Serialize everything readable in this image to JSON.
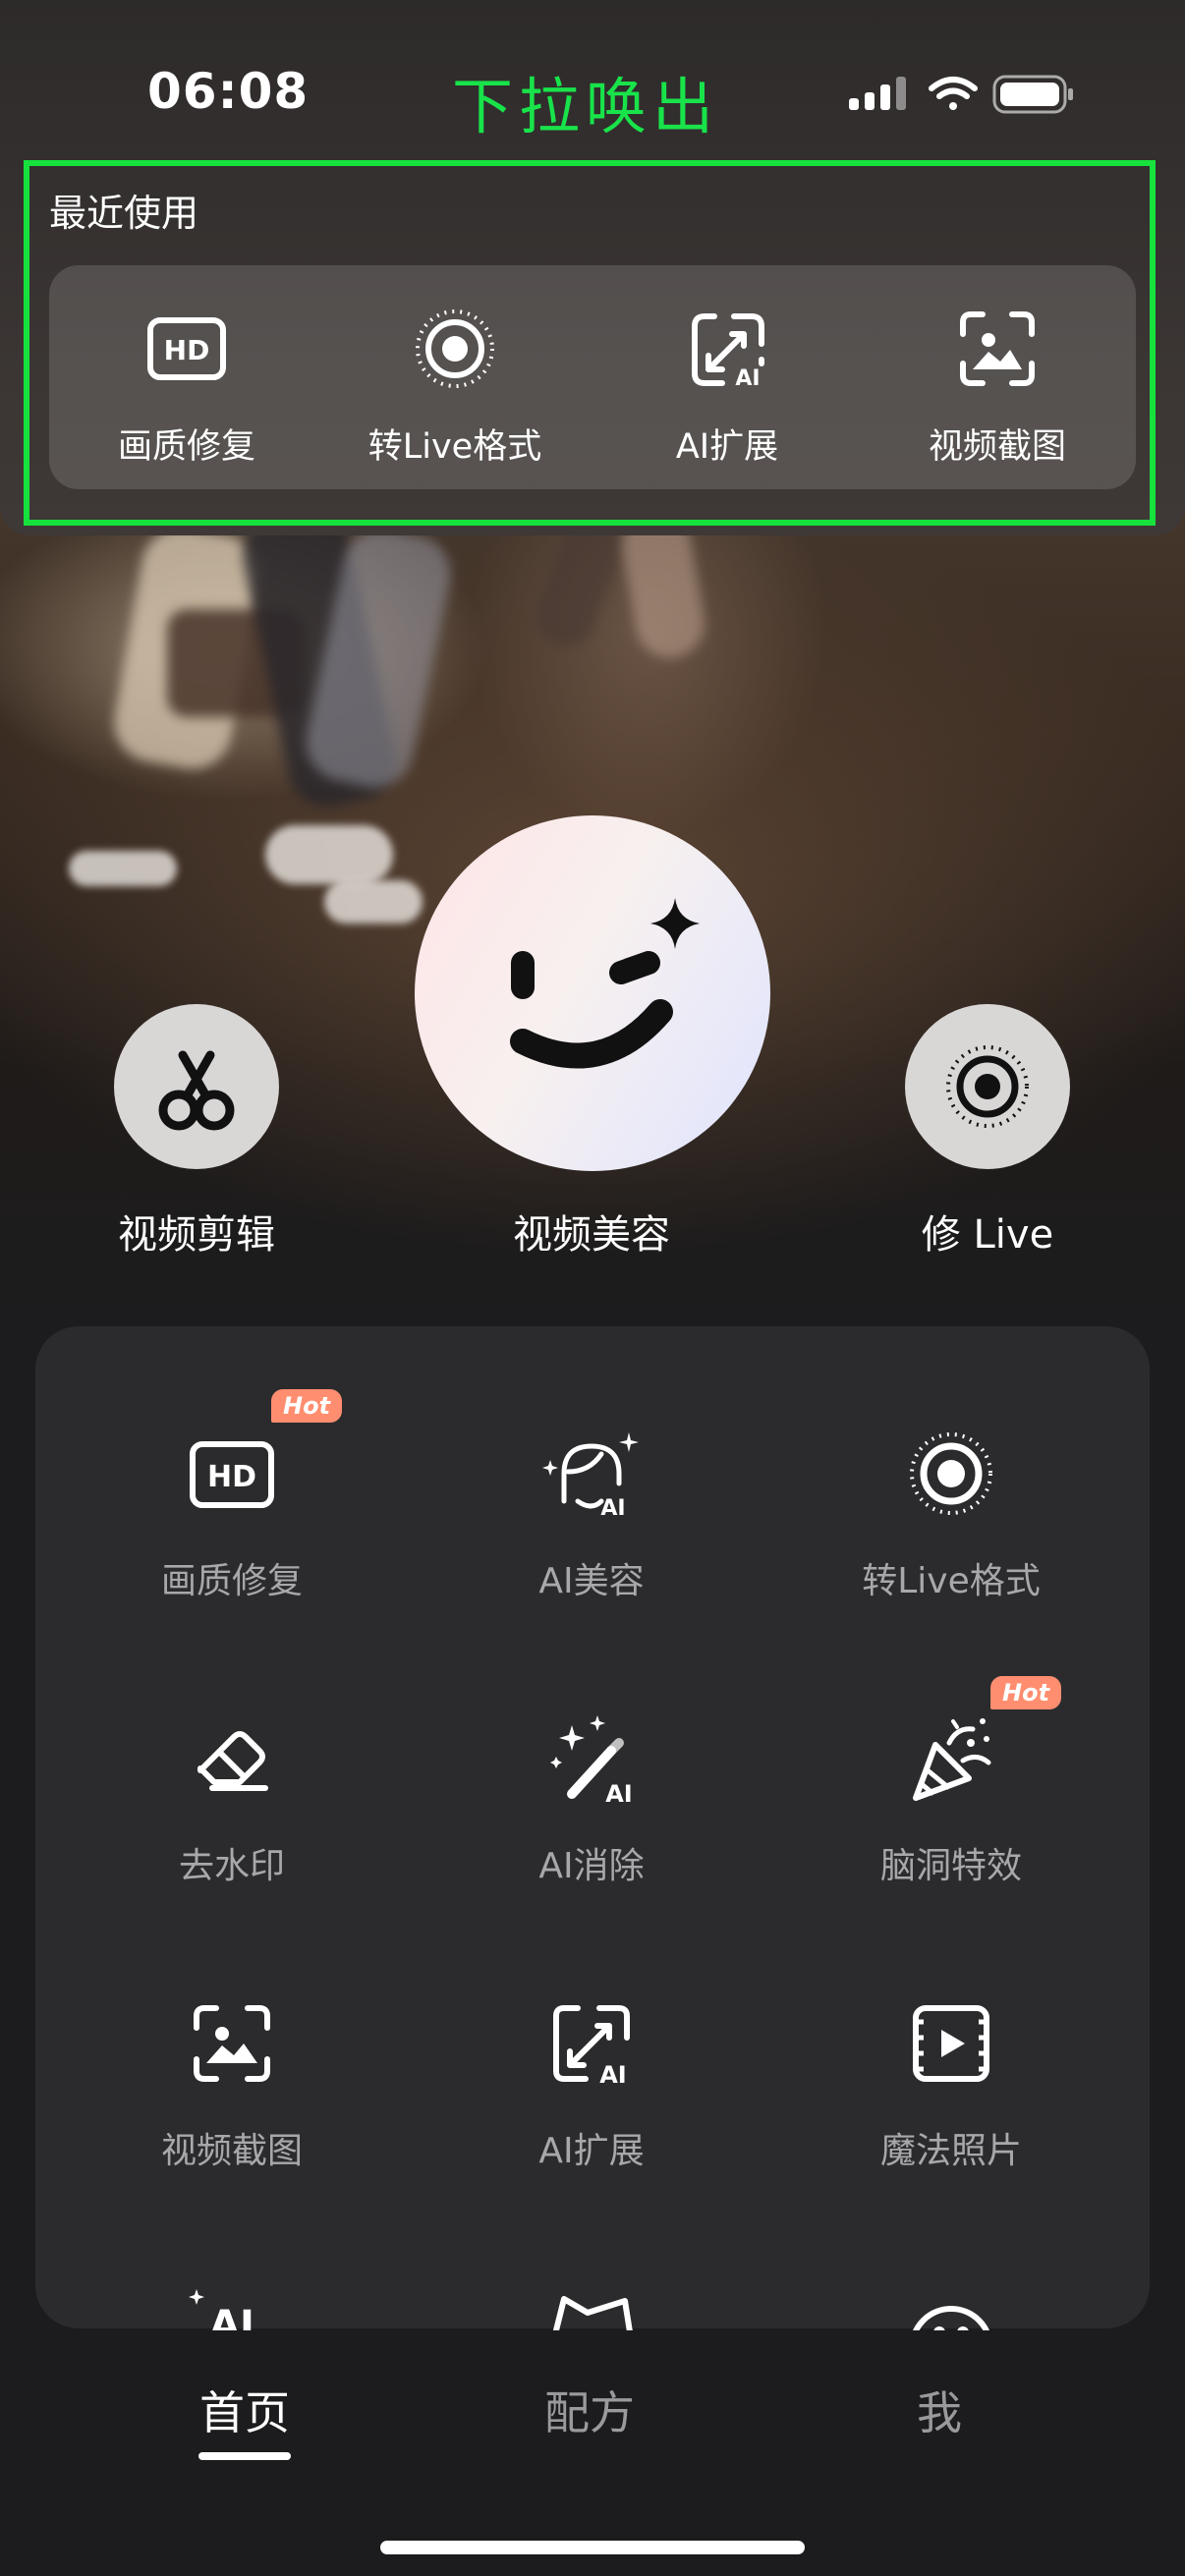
{
  "status_bar": {
    "time": "06:08"
  },
  "overlay_title": "下拉唤出",
  "recent": {
    "title": "最近使用",
    "items": [
      {
        "label": "画质修复",
        "icon": "hd-icon"
      },
      {
        "label": "转Live格式",
        "icon": "live-photo-icon"
      },
      {
        "label": "AI扩展",
        "icon": "ai-expand-icon"
      },
      {
        "label": "视频截图",
        "icon": "video-screenshot-icon"
      }
    ]
  },
  "main_actions": {
    "video_edit": "视频剪辑",
    "video_beauty": "视频美容",
    "fix_live": "修 Live"
  },
  "tools": [
    {
      "label": "画质修复",
      "icon": "hd-icon",
      "badge": "Hot"
    },
    {
      "label": "AI美容",
      "icon": "ai-face-icon"
    },
    {
      "label": "转Live格式",
      "icon": "live-photo-icon"
    },
    {
      "label": "去水印",
      "icon": "eraser-icon"
    },
    {
      "label": "AI消除",
      "icon": "magic-wand-icon"
    },
    {
      "label": "脑洞特效",
      "icon": "party-popper-icon",
      "badge": "Hot"
    },
    {
      "label": "视频截图",
      "icon": "video-screenshot-icon"
    },
    {
      "label": "AI扩展",
      "icon": "ai-expand-icon"
    },
    {
      "label": "魔法照片",
      "icon": "magic-photo-icon"
    }
  ],
  "tabs": [
    {
      "label": "首页",
      "active": true
    },
    {
      "label": "配方",
      "active": false
    },
    {
      "label": "我",
      "active": false
    }
  ],
  "colors": {
    "highlight_green": "#17e13d",
    "hot_badge": "#ff8e70"
  }
}
